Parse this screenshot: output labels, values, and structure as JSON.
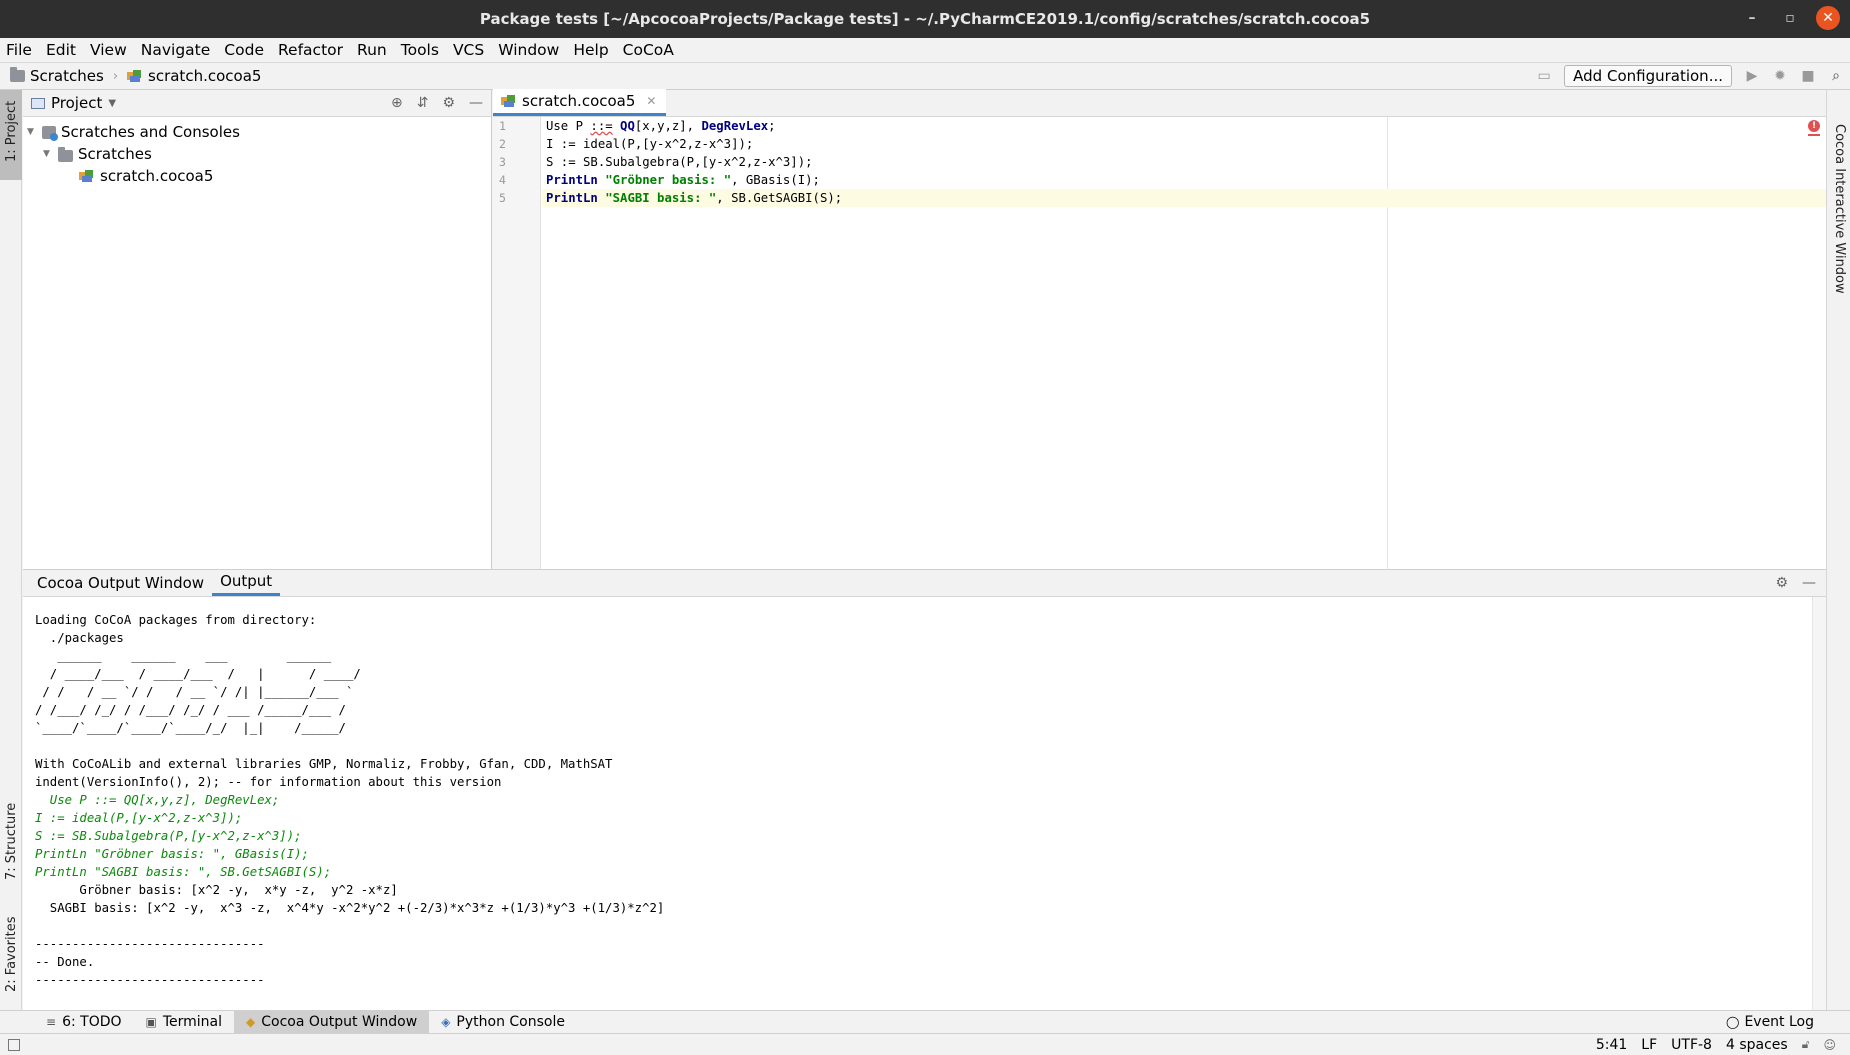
{
  "window": {
    "title": "Package tests [~/ApcocoaProjects/Package tests] - ~/.PyCharmCE2019.1/config/scratches/scratch.cocoa5",
    "minimize": "–",
    "maximize": "▫",
    "close": "✕"
  },
  "menu": [
    "File",
    "Edit",
    "View",
    "Navigate",
    "Code",
    "Refactor",
    "Run",
    "Tools",
    "VCS",
    "Window",
    "Help",
    "CoCoA"
  ],
  "breadcrumb": {
    "folder": "Scratches",
    "file": "scratch.cocoa5"
  },
  "toolbar": {
    "add_configuration": "Add Configuration..."
  },
  "left_strip": {
    "project": "1: Project",
    "structure": "7: Structure",
    "favorites": "2: Favorites"
  },
  "right_strip": {
    "interactive": "Cocoa Interactive Window"
  },
  "project_panel": {
    "title": "Project",
    "tree": [
      {
        "label": "Scratches and Consoles",
        "level": 0
      },
      {
        "label": "Scratches",
        "level": 1
      },
      {
        "label": "scratch.cocoa5",
        "level": 2
      }
    ]
  },
  "editor": {
    "tab": "scratch.cocoa5",
    "line_numbers": [
      "1",
      "2",
      "3",
      "4",
      "5"
    ]
  },
  "output": {
    "tabs": [
      "Cocoa Output Window",
      "Output"
    ],
    "active_tab": "Output",
    "lines": [
      "Loading CoCoA packages from directory:",
      "  ./packages",
      "   ______    ______    ___        ______",
      "  / ____/___  / ____/___  /   |      / ____/",
      " / /   / __ `/ /   / __ `/ /| |______/___ `",
      "/ /___/ /_/ / /___/ /_/ / ___ /_____/___ /",
      "`____/`____/`____/`____/_/  |_|    /_____/",
      "",
      "With CoCoALib and external libraries GMP, Normaliz, Frobby, Gfan, CDD, MathSAT",
      "indent(VersionInfo(), 2); -- for information about this version",
      "  Use P ::= QQ[x,y,z], DegRevLex;",
      "I := ideal(P,[y-x^2,z-x^3]);",
      "S := SB.Subalgebra(P,[y-x^2,z-x^3]);",
      "PrintLn \"Gröbner basis: \", GBasis(I);",
      "PrintLn \"SAGBI basis: \", SB.GetSAGBI(S);",
      "      Gröbner basis: [x^2 -y,  x*y -z,  y^2 -x*z]",
      "  SAGBI basis: [x^2 -y,  x^3 -z,  x^4*y -x^2*y^2 +(-2/3)*x^3*z +(1/3)*y^3 +(1/3)*z^2]",
      "",
      "-------------------------------",
      "-- Done.",
      "-------------------------------"
    ],
    "echo_line_indices": [
      10,
      11,
      12,
      13,
      14
    ]
  },
  "bottom_tabs": [
    {
      "label": "6: TODO",
      "icon": "≡"
    },
    {
      "label": "Terminal",
      "icon": "▣"
    },
    {
      "label": "Cocoa Output Window",
      "icon": "◆",
      "active": true
    },
    {
      "label": "Python Console",
      "icon": "◈"
    }
  ],
  "event_log": "Event Log",
  "status": {
    "position": "5:41",
    "line_ending": "LF",
    "encoding": "UTF-8",
    "indent": "4 spaces"
  }
}
